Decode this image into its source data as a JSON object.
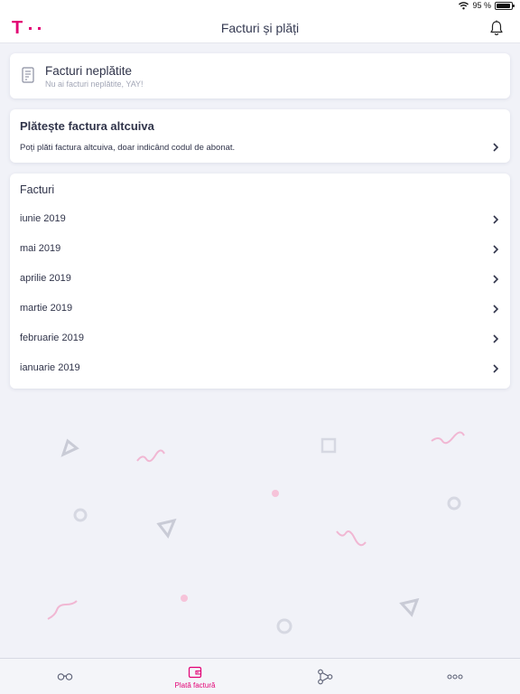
{
  "status": {
    "battery_text": "95 %",
    "battery_level": 0.95
  },
  "header": {
    "title": "Facturi și plăți"
  },
  "unpaid": {
    "title": "Facturi neplătite",
    "subtitle": "Nu ai facturi neplătite, YAY!"
  },
  "pay_other": {
    "title": "Plătește factura altcuiva",
    "description": "Poți plăti factura altcuiva, doar indicând codul de abonat."
  },
  "invoices": {
    "title": "Facturi",
    "items": [
      {
        "label": "iunie 2019"
      },
      {
        "label": "mai 2019"
      },
      {
        "label": "aprilie 2019"
      },
      {
        "label": "martie 2019"
      },
      {
        "label": "februarie 2019"
      },
      {
        "label": "ianuarie 2019"
      }
    ]
  },
  "tabbar": {
    "tabs": [
      {
        "icon": "glasses-icon",
        "label": ""
      },
      {
        "icon": "wallet-icon",
        "label": "Plată factură",
        "active": true
      },
      {
        "icon": "network-icon",
        "label": ""
      },
      {
        "icon": "more-dots-icon",
        "label": ""
      }
    ]
  },
  "colors": {
    "brand": "#e20074",
    "background": "#f1f2f8",
    "text": "#30344a",
    "muted": "#a2a6b6"
  }
}
